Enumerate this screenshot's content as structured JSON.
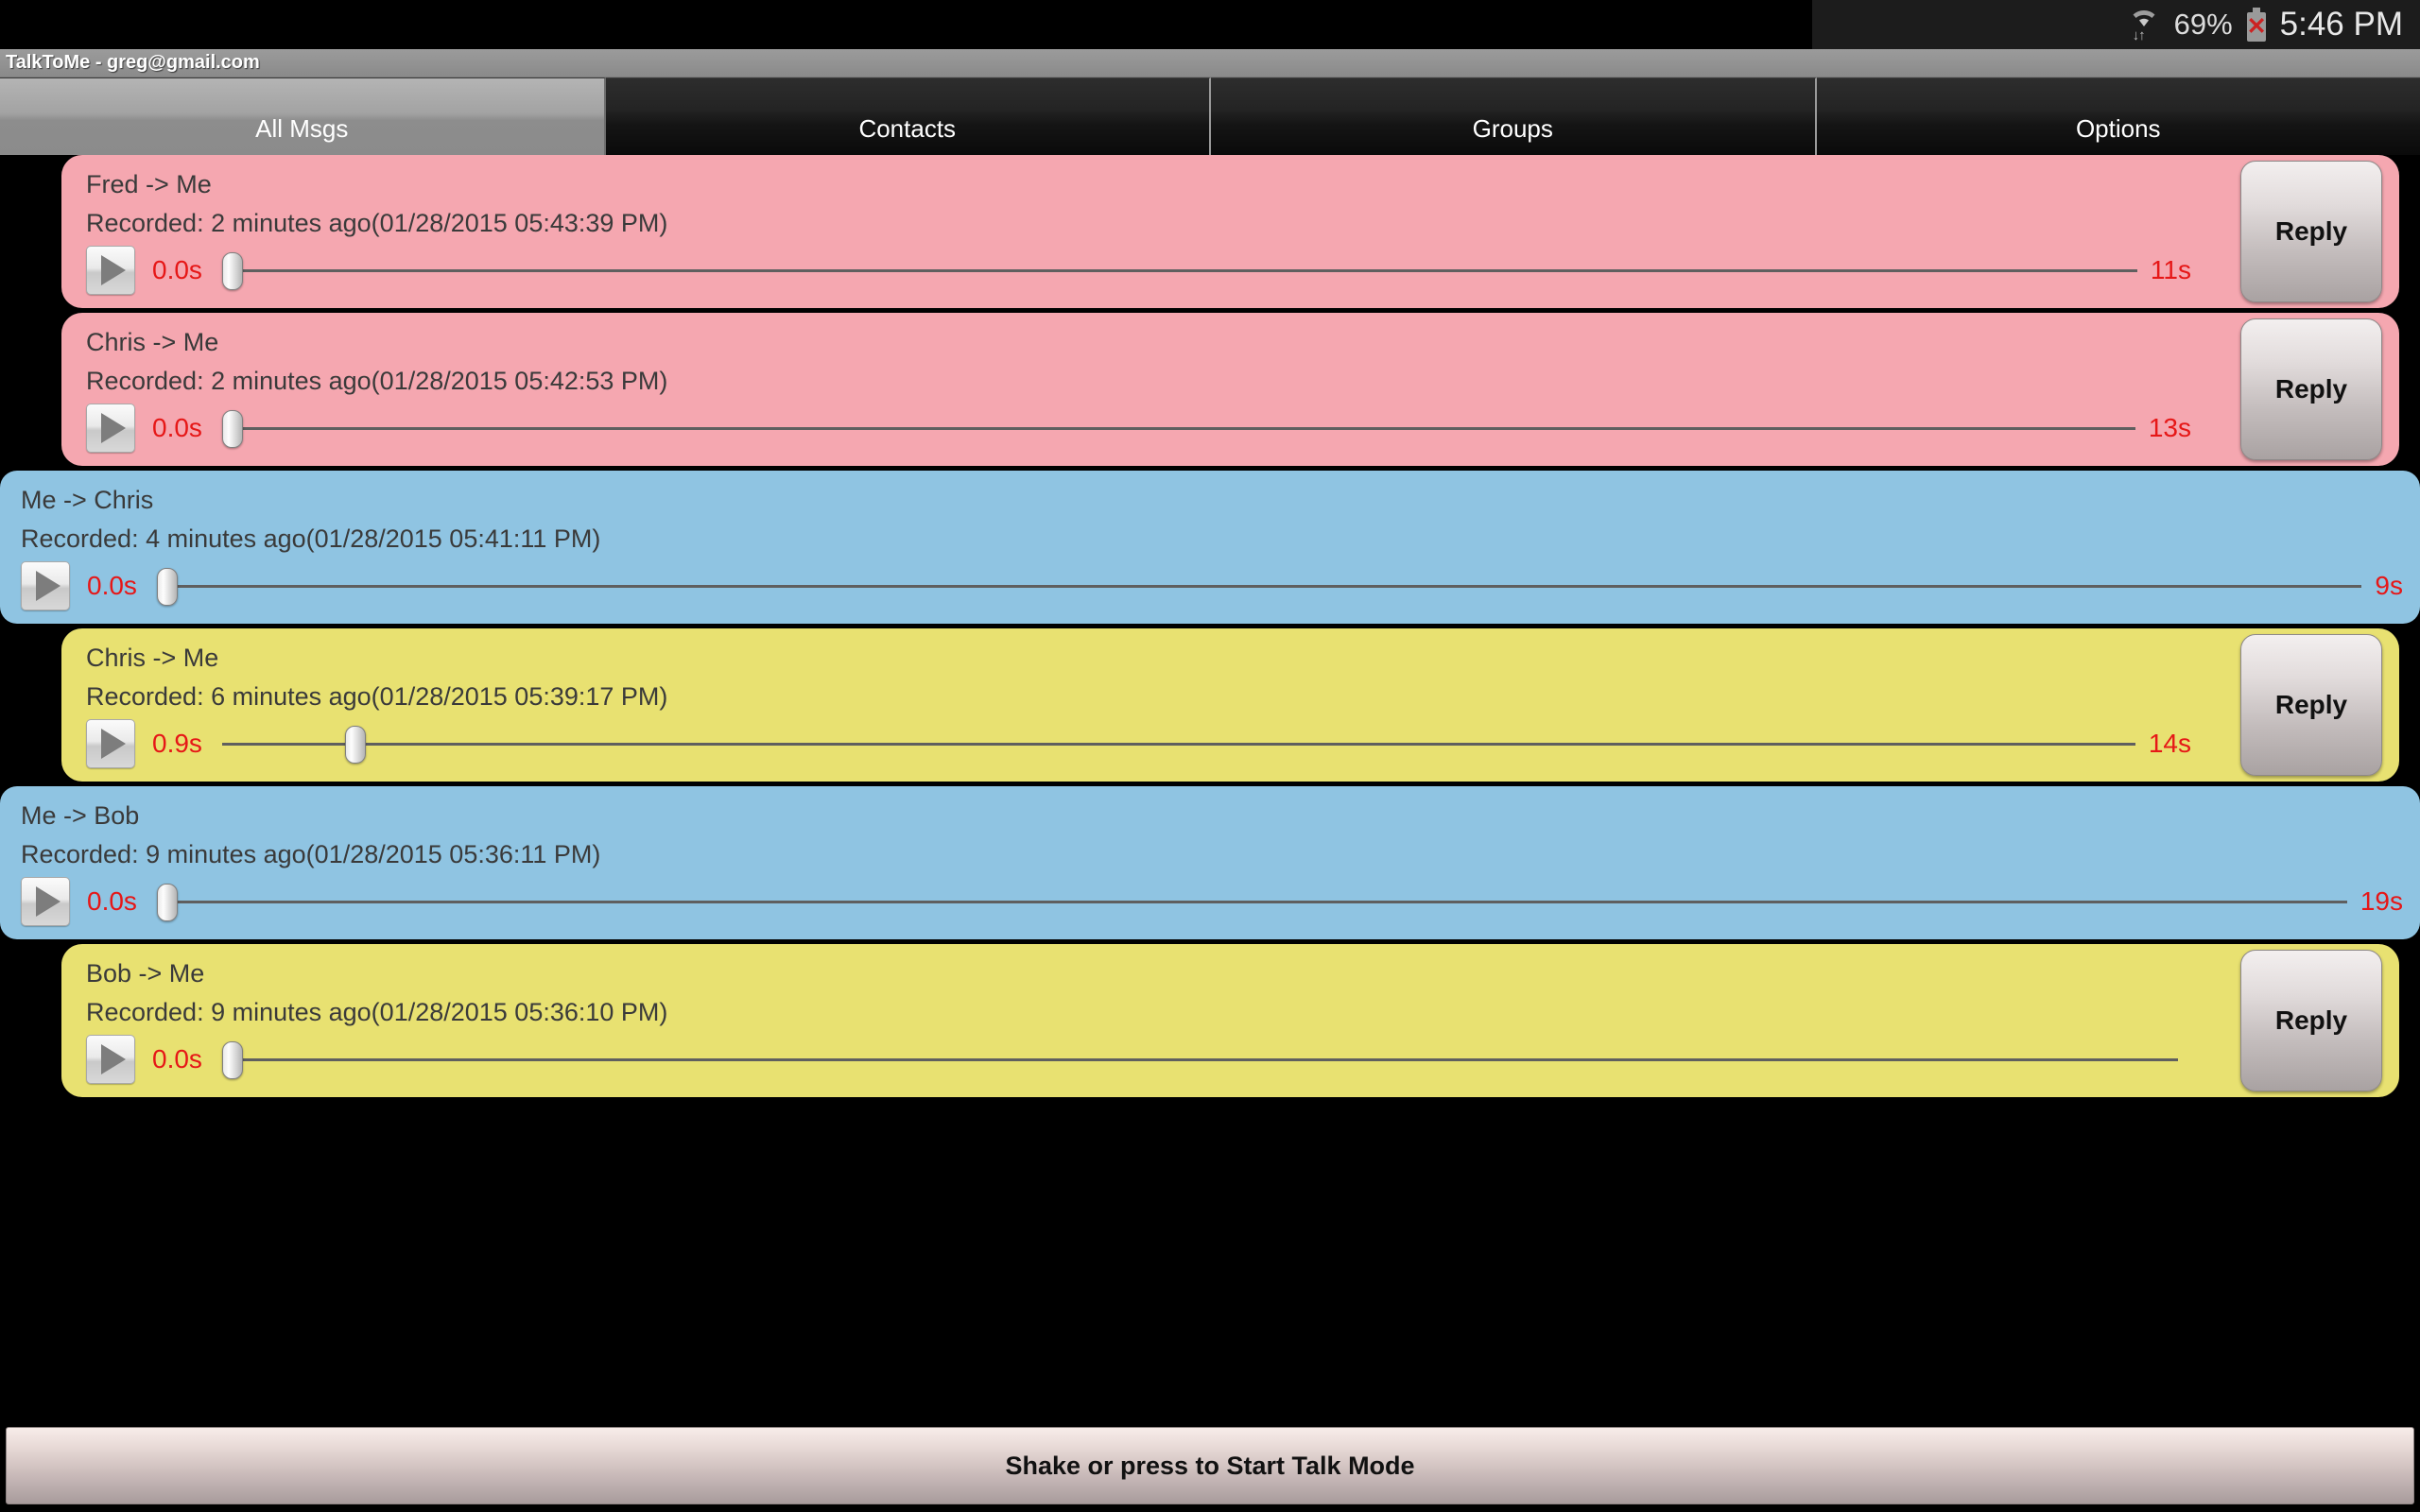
{
  "status_bar": {
    "wifi_icon": "wifi-icon",
    "data_arrows_icon": "data-transfer-arrows-icon",
    "battery_percent": "69%",
    "battery_icon": "battery-error-icon",
    "clock": "5:46 PM"
  },
  "title_bar": {
    "title": "TalkToMe - greg@gmail.com"
  },
  "tabs": [
    {
      "label": "All Msgs",
      "active": true
    },
    {
      "label": "Contacts",
      "active": false
    },
    {
      "label": "Groups",
      "active": false
    },
    {
      "label": "Options",
      "active": false
    }
  ],
  "colors": {
    "incoming_unread": "#f5a7b0",
    "outgoing": "#8fc4e2",
    "incoming_read": "#e8e171",
    "time_text": "#e61717",
    "accent_tab_active": "#a3a3a3"
  },
  "messages": [
    {
      "who": "Fred -> Me",
      "recorded": "Recorded: 2 minutes ago(01/28/2015 05:43:39 PM)",
      "current_time": "0.0s",
      "duration": "11s",
      "progress_percent": 0,
      "color": "pink",
      "reply_label": "Reply",
      "has_reply": true
    },
    {
      "who": "Chris -> Me",
      "recorded": "Recorded: 2 minutes ago(01/28/2015 05:42:53 PM)",
      "current_time": "0.0s",
      "duration": "13s",
      "progress_percent": 0,
      "color": "pink",
      "reply_label": "Reply",
      "has_reply": true
    },
    {
      "who": "Me -> Chris",
      "recorded": "Recorded: 4 minutes ago(01/28/2015 05:41:11 PM)",
      "current_time": "0.0s",
      "duration": "9s",
      "progress_percent": 0,
      "color": "blue",
      "reply_label": "",
      "has_reply": false
    },
    {
      "who": "Chris -> Me",
      "recorded": "Recorded: 6 minutes ago(01/28/2015 05:39:17 PM)",
      "current_time": "0.9s",
      "duration": "14s",
      "progress_percent": 6.4,
      "color": "yellow",
      "reply_label": "Reply",
      "has_reply": true
    },
    {
      "who": "Me -> Bob",
      "recorded": "Recorded: 9 minutes ago(01/28/2015 05:36:11 PM)",
      "current_time": "0.0s",
      "duration": "19s",
      "progress_percent": 0,
      "color": "blue",
      "reply_label": "",
      "has_reply": false
    },
    {
      "who": "Bob -> Me",
      "recorded": "Recorded: 9 minutes ago(01/28/2015 05:36:10 PM)",
      "current_time": "0.0s",
      "duration": "",
      "progress_percent": 0,
      "color": "yellow",
      "reply_label": "Reply",
      "has_reply": true
    }
  ],
  "talk_bar": {
    "label": "Shake or press to Start Talk Mode"
  }
}
